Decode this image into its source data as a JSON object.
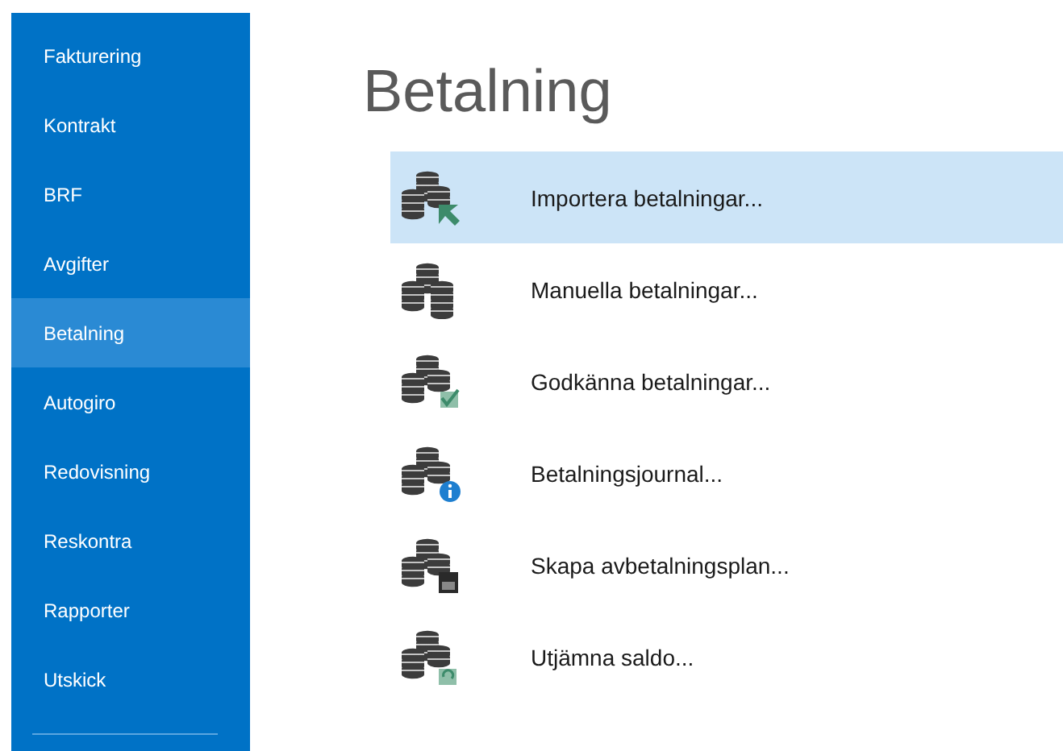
{
  "sidebar": {
    "items": [
      {
        "label": "Fakturering",
        "selected": false
      },
      {
        "label": "Kontrakt",
        "selected": false
      },
      {
        "label": "BRF",
        "selected": false
      },
      {
        "label": "Avgifter",
        "selected": false
      },
      {
        "label": "Betalning",
        "selected": true
      },
      {
        "label": "Autogiro",
        "selected": false
      },
      {
        "label": "Redovisning",
        "selected": false
      },
      {
        "label": "Reskontra",
        "selected": false
      },
      {
        "label": "Rapporter",
        "selected": false
      },
      {
        "label": "Utskick",
        "selected": false
      }
    ]
  },
  "page": {
    "title": "Betalning",
    "actions": [
      {
        "label": "Importera betalningar...",
        "kind": "import",
        "selected": true
      },
      {
        "label": "Manuella betalningar...",
        "kind": "plain",
        "selected": false
      },
      {
        "label": "Godkänna betalningar...",
        "kind": "approve",
        "selected": false
      },
      {
        "label": "Betalningsjournal...",
        "kind": "info",
        "selected": false
      },
      {
        "label": "Skapa avbetalningsplan...",
        "kind": "calendar",
        "selected": false
      },
      {
        "label": "Utjämna saldo...",
        "kind": "refresh",
        "selected": false
      }
    ]
  }
}
